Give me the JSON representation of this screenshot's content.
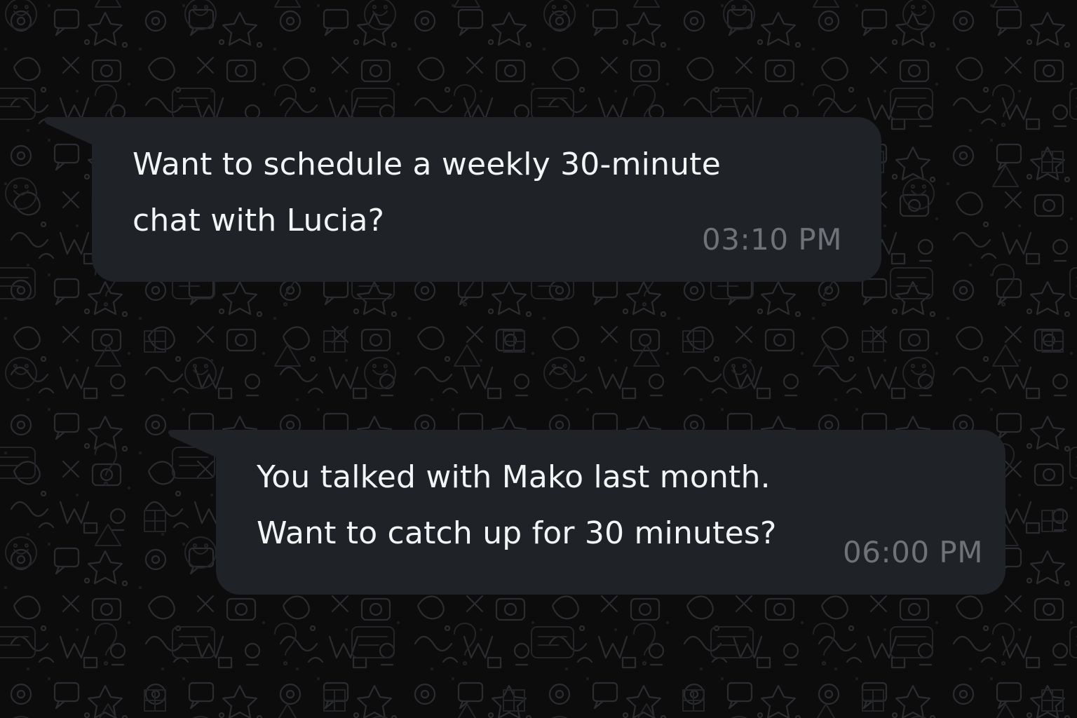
{
  "conversation": {
    "messages": [
      {
        "text": "Want to schedule a weekly 30-minute\nchat with Lucia?",
        "time": "03:10 PM"
      },
      {
        "text": "You talked with Mako last month.\nWant to catch up for 30 minutes?",
        "time": "06:00 PM"
      }
    ]
  },
  "colors": {
    "background": "#0c0c0d",
    "bubble": "#1f2226",
    "message_text": "#f3f4f5",
    "timestamp": "#6f7378"
  }
}
